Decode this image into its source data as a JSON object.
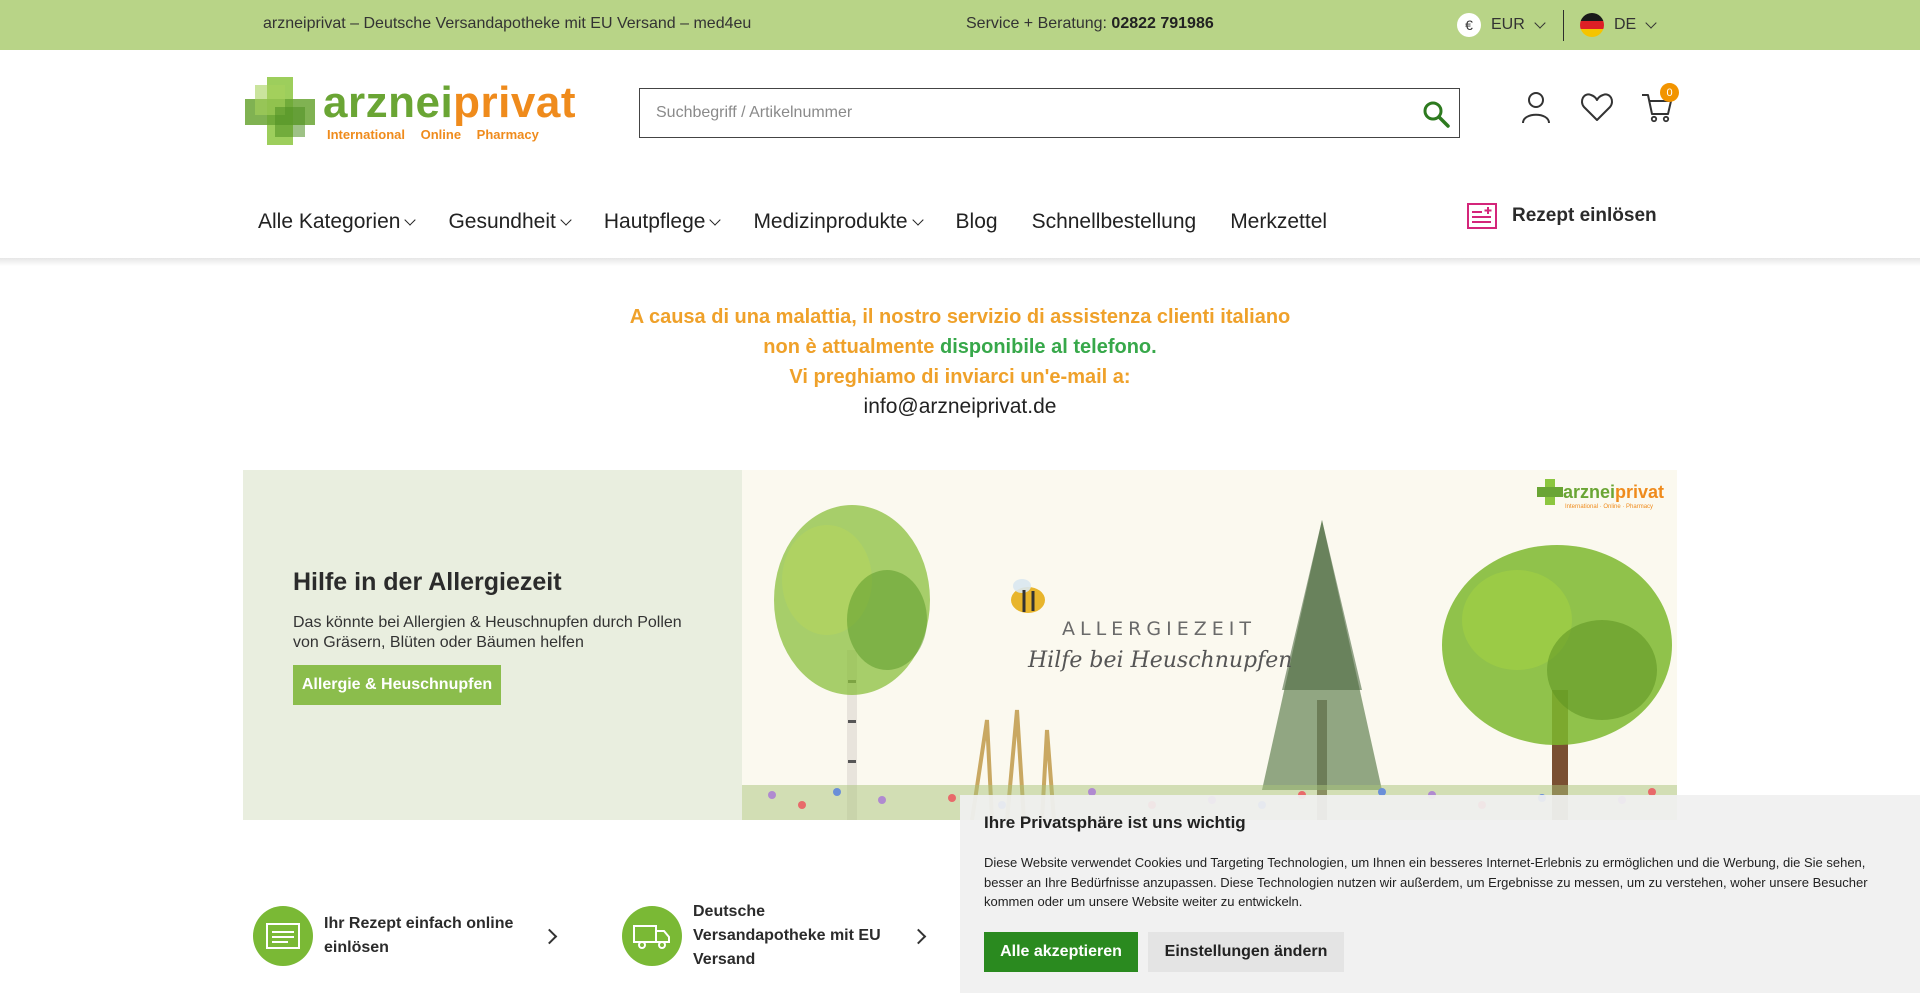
{
  "topbar": {
    "tagline": "arzneiprivat – Deutsche Versandapotheke mit EU Versand – med4eu",
    "service_label": "Service + Beratung:",
    "service_phone": "02822 791986",
    "currency_symbol": "€",
    "currency": "EUR",
    "language": "DE"
  },
  "logo": {
    "word_part1": "arznei",
    "word_part2": "privat",
    "tagline": "International Online Pharmacy"
  },
  "search": {
    "placeholder": "Suchbegriff / Artikelnummer"
  },
  "cart": {
    "count": "0"
  },
  "nav": {
    "items": [
      {
        "label": "Alle Kategorien",
        "dropdown": true
      },
      {
        "label": "Gesundheit",
        "dropdown": true
      },
      {
        "label": "Hautpflege",
        "dropdown": true
      },
      {
        "label": "Medizinprodukte",
        "dropdown": true
      },
      {
        "label": "Blog",
        "dropdown": false
      },
      {
        "label": "Schnellbestellung",
        "dropdown": false
      },
      {
        "label": "Merkzettel",
        "dropdown": false
      }
    ],
    "rezept_label": "Rezept einlösen"
  },
  "notice": {
    "line1": "A causa di una malattia, il nostro servizio di assistenza clienti italiano",
    "line2_part1": "non è attualmente ",
    "line2_part2": "disponibile al telefono.",
    "line3": "Vi preghiamo di inviarci un'e-mail a:",
    "email": "info@arzneiprivat.de"
  },
  "banner": {
    "title": "Hilfe in der Allergiezeit",
    "description": "Das könnte bei Allergien & Heuschnupfen durch Pollen von Gräsern, Blüten oder Bäumen helfen",
    "button_label": "Allergie & Heuschnupfen",
    "image_headline": "ALLERGIEZEIT",
    "image_subline": "Hilfe bei Heuschnupfen",
    "image_logo_part1": "arznei",
    "image_logo_part2": "privat",
    "image_logo_tagline": "International · Online · Pharmacy"
  },
  "features": [
    {
      "label": "Ihr Rezept einfach online einlösen"
    },
    {
      "label": "Deutsche Versandapotheke mit EU Versand"
    }
  ],
  "cookie": {
    "title": "Ihre Privatsphäre ist uns wichtig",
    "text": "Diese Website verwendet Cookies und Targeting Technologien, um Ihnen ein besseres Internet-Erlebnis zu ermöglichen und die Werbung, die Sie sehen, besser an Ihre Bedürfnisse anzupassen. Diese Technologien nutzen wir außerdem, um Ergebnisse zu messen, um zu verstehen, woher unsere Besucher kommen oder um unsere Website weiter zu entwickeln.",
    "accept_label": "Alle akzeptieren",
    "settings_label": "Einstellungen ändern"
  },
  "colors": {
    "topbar_bg": "#b8d487",
    "brand_green": "#6aa534",
    "brand_orange": "#ef8b1c",
    "button_green": "#8bbd4c",
    "accept_green": "#2a8a1f",
    "notice_orange": "#efa12a",
    "notice_green": "#37a84a"
  }
}
